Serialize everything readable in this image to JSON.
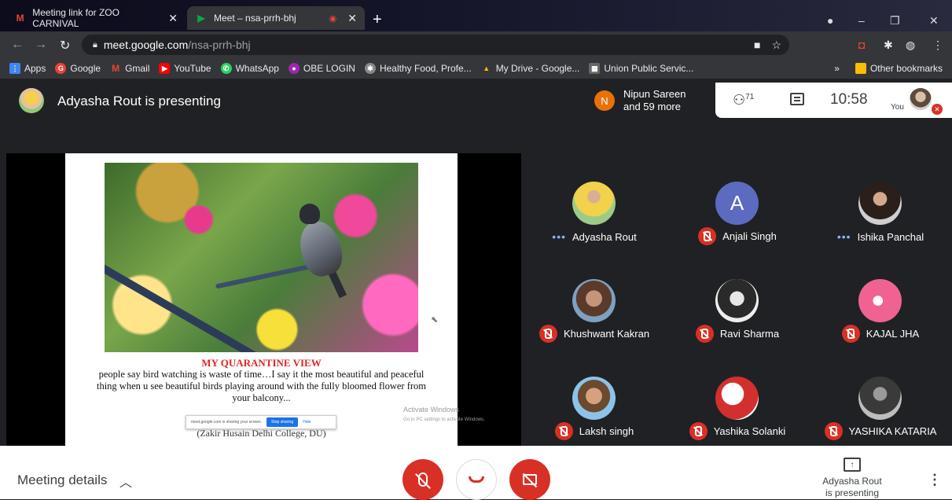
{
  "browser": {
    "tabs": [
      {
        "title": "Meeting link for ZOO CARNIVAL",
        "icon": "gmail-icon"
      },
      {
        "title": "Meet – nsa-prrh-bhj",
        "icon": "meet-icon",
        "recording": true
      }
    ],
    "url_host": "meet.google.com",
    "url_path": "/nsa-prrh-bhj",
    "bookmarks": [
      {
        "label": "Apps",
        "color": "#4285f4"
      },
      {
        "label": "Google",
        "color": "#ea4335"
      },
      {
        "label": "Gmail",
        "color": "#ea4335"
      },
      {
        "label": "YouTube",
        "color": "#ff0000"
      },
      {
        "label": "WhatsApp",
        "color": "#25d366"
      },
      {
        "label": "OBE LOGIN",
        "color": "#9c27b0"
      },
      {
        "label": "Healthy Food, Profe...",
        "color": "#888888"
      },
      {
        "label": "My Drive - Google...",
        "color": "#fbbc04"
      },
      {
        "label": "Union Public Servic...",
        "color": "#666666"
      }
    ],
    "bookmarks_overflow": "»",
    "other_bookmarks": "Other bookmarks"
  },
  "meet": {
    "presenting_text": "Adyasha Rout is presenting",
    "participants_card": {
      "initial": "N",
      "line1": "Nipun Sareen",
      "line2": "and 59 more"
    },
    "people_count": "71",
    "time": "10:58",
    "you_label": "You",
    "slide": {
      "title": "MY QUARANTINE VIEW",
      "body": "people say bird watching is waste of time…I say it the most beautiful and peaceful thing when u see beautiful birds playing around with the fully bloomed flower from your balcony...",
      "footer": "(Zakir Husain Delhi College, DU)",
      "share_bar_text": "meet.google.com is sharing your screen.",
      "stop_sharing": "Stop sharing",
      "hide": "Hide"
    },
    "activate_windows": {
      "title": "Activate Windows",
      "subtitle": "Go to PC settings to activate Windows."
    },
    "tiles": [
      {
        "name": "Adyasha Rout",
        "status": "speaking"
      },
      {
        "name": "Anjali Singh",
        "status": "muted",
        "initial": "A"
      },
      {
        "name": "Ishika Panchal",
        "status": "speaking"
      },
      {
        "name": "Khushwant Kakran",
        "status": "muted"
      },
      {
        "name": "Ravi Sharma",
        "status": "muted"
      },
      {
        "name": "KAJAL JHA",
        "status": "muted"
      },
      {
        "name": "Laksh singh",
        "status": "muted"
      },
      {
        "name": "Yashika Solanki",
        "status": "muted"
      },
      {
        "name": "YASHIKA KATARIA",
        "status": "muted"
      }
    ],
    "bottom": {
      "meeting_details": "Meeting details",
      "presenting_line1": "Adyasha Rout",
      "presenting_line2": "is presenting"
    }
  },
  "colors": {
    "accent_red": "#d93025",
    "blue": "#1a73e8",
    "bg_dark": "#202124"
  }
}
